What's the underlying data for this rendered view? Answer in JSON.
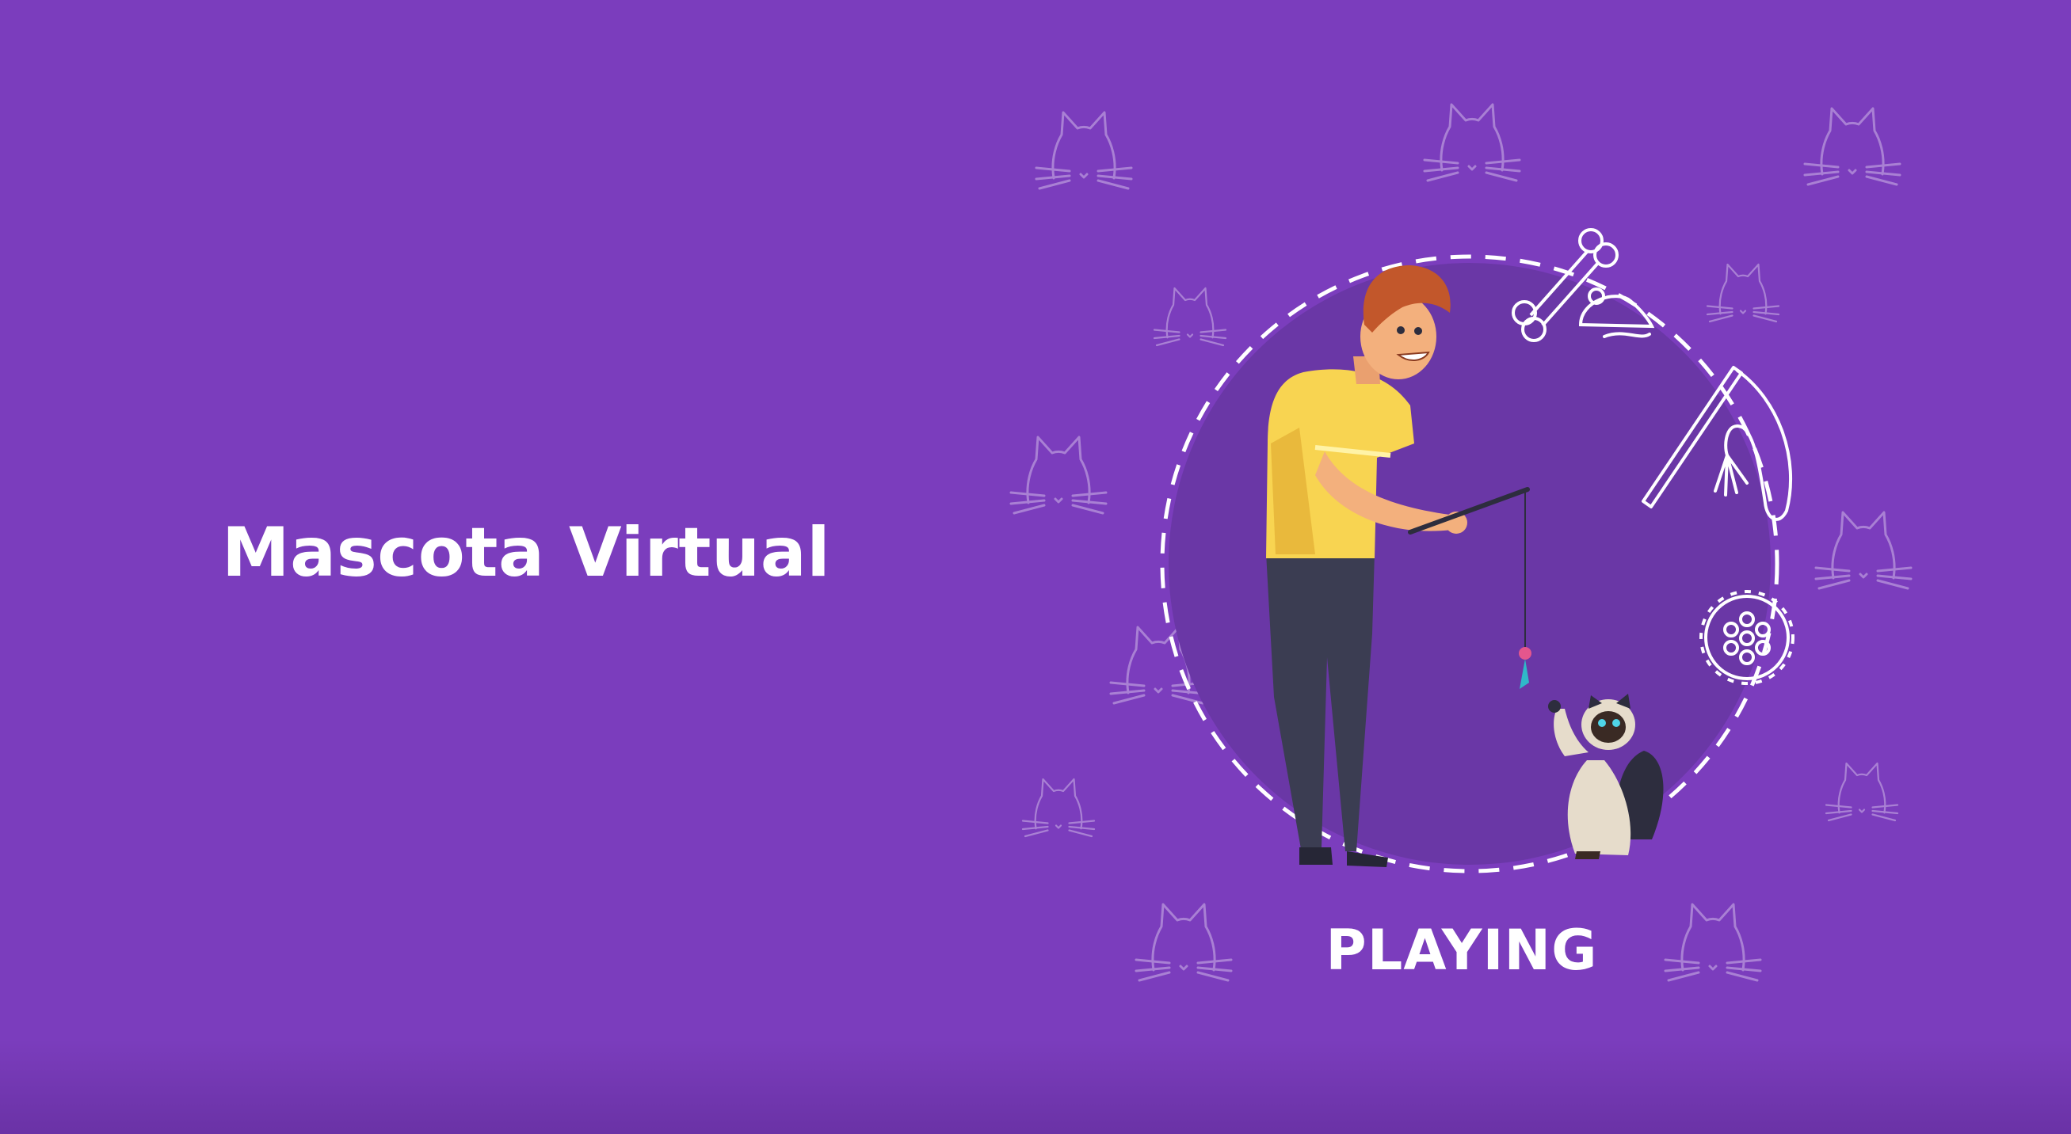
{
  "app": {
    "title": "Mascota Virtual"
  },
  "pet": {
    "state": "PLAYING"
  },
  "colors": {
    "background": "#7b3dbd",
    "circle": "#6a37a6",
    "outline": "#ffffff",
    "shirt": "#f8d451",
    "pants": "#3b3d52",
    "hair": "#c2572b"
  },
  "icons": [
    "cat-face-icon",
    "bone-icon",
    "toy-mouse-icon",
    "wand-toy-icon",
    "spiky-ball-icon"
  ]
}
